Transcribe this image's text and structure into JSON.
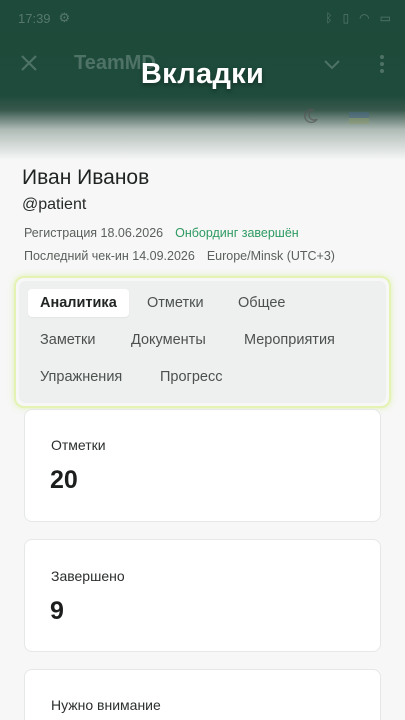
{
  "status_bar": {
    "time": "17:39"
  },
  "app_bar": {
    "app_name": "TeamMD"
  },
  "overlay_title": "Вкладки",
  "profile": {
    "name": "Иван Иванов",
    "handle": "@patient",
    "registration": "Регистрация 18.06.2026",
    "onboarding": "Онбординг завершён",
    "last_checkin": "Последний чек-ин 14.09.2026",
    "timezone": "Europe/Minsk (UTC+3)"
  },
  "tabs": [
    {
      "label": "Аналитика",
      "active": true
    },
    {
      "label": "Отметки",
      "active": false
    },
    {
      "label": "Общее",
      "active": false
    },
    {
      "label": "Заметки",
      "active": false
    },
    {
      "label": "Документы",
      "active": false
    },
    {
      "label": "Мероприятия",
      "active": false
    },
    {
      "label": "Упражнения",
      "active": false
    },
    {
      "label": "Прогресс",
      "active": false
    }
  ],
  "stats": [
    {
      "label": "Отметки",
      "value": "20"
    },
    {
      "label": "Завершено",
      "value": "9"
    },
    {
      "label": "Нужно внимание",
      "value": ""
    }
  ],
  "colors": {
    "header_bg": "#1d4a3a",
    "accent_green": "#2e9a62",
    "tab_highlight": "#e4f3b3"
  }
}
